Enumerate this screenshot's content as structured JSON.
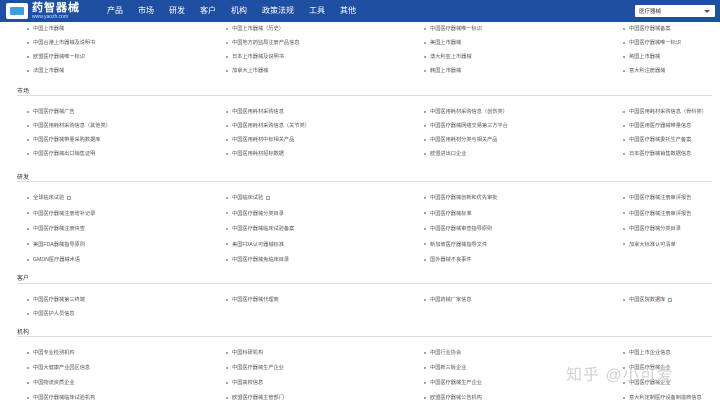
{
  "header": {
    "logo_name": "药智器械",
    "logo_sub": "www.yaozh.com",
    "nav": [
      "产品",
      "市场",
      "研发",
      "客户",
      "机构",
      "政策法规",
      "工具",
      "其他"
    ],
    "search_scope": "医疗器械"
  },
  "sections": {
    "top": [
      [
        "中国上市器械",
        "中国上市器械（历史）",
        "中国医疗器械唯一标识",
        "中国医疗器械备案"
      ],
      [
        "中国台港上市器械及说明书",
        "中国地方药监局注册产品信息",
        "美国上市器械",
        "中国医疗器械唯一标识"
      ],
      [
        "欧盟医疗器械唯一标识",
        "日本上市器械及说明书",
        "澳大利亚上市器械",
        "英国上市器械"
      ],
      [
        "法国上市器械",
        "加拿大上市器械",
        "韩国上市器械",
        "意大利注册器械"
      ]
    ],
    "market_title": "市场",
    "market": [
      [
        "中国医疗器械广告",
        "中国医用耗材采购信息",
        "中国医用耗材采购信息（创伤类）",
        "中国医用耗材采购信息（骨科类）"
      ],
      [
        "中国医用耗材采购信息（其他类）",
        "中国医用耗材采购信息（关节类）",
        "中国医疗器械网络交易第三方平台",
        "中国医用医疗器械带量信息"
      ],
      [
        "中国医疗器械带量采购数据库",
        "中国医用耗材中标相关产品",
        "中国医用耗材分类与相关产品",
        "中国医疗器械委托生产备案"
      ],
      [
        "中国医疗器械出口销售证明",
        "中国医用耗材招标数据",
        "欧盟进出口企业",
        "日本医疗器械销售数据信息"
      ]
    ],
    "rd_title": "研发",
    "rd": [
      [
        "全球临床试验",
        "中国临床试验",
        "中国医疗器械创新和优先审批",
        "中国医疗器械注册审评报告"
      ],
      [
        "中国医疗器械注册增补记录",
        "中国医疗器械分类目录",
        "中国医疗器械标准",
        "中国医疗器械注册审评报告"
      ],
      [
        "中国医疗器械注册快查",
        "中国医疗器械临床试验备案",
        "中国医疗器械审查指导原则",
        "中国医疗器械分类目录"
      ],
      [
        "美国FDA器械指导原则",
        "美国FDA认可器械标准",
        "新加坡医疗器械指导文件",
        "加拿大标准认可清单"
      ],
      [
        "GMDN医疗器械术语",
        "中国医疗器械免临床目录",
        "国外器械不良事件",
        ""
      ]
    ],
    "client_title": "客户",
    "client": [
      [
        "中国医疗器械第三终端",
        "中国医疗器械代理商",
        "中国药械厂家信息",
        "中国医院数据库"
      ],
      [
        "中国医护人员信息",
        "",
        "",
        ""
      ]
    ],
    "org_title": "机构",
    "org": [
      [
        "中国专业检测机构",
        "中国科研机构",
        "中国行业协会",
        "中国上市企业信息"
      ],
      [
        "中国大健康产业园区信息",
        "中国医疗器械生产企业",
        "中国新三板企业",
        "中国医疗器械企业"
      ],
      [
        "中国物流资质企业",
        "中国高校信息",
        "中国医疗器械生产企业",
        "中国医疗器械企业"
      ],
      [
        "中国医疗器械临床试验机构",
        "欧盟医疗器械主管部门",
        "欧盟医疗器械公告机构",
        "意大利定制医疗设备制造商信息"
      ]
    ],
    "watermark": "知乎 @小可爱"
  },
  "colors": {
    "topbar": "#1f4fa0",
    "divider": "#d8dde6"
  }
}
